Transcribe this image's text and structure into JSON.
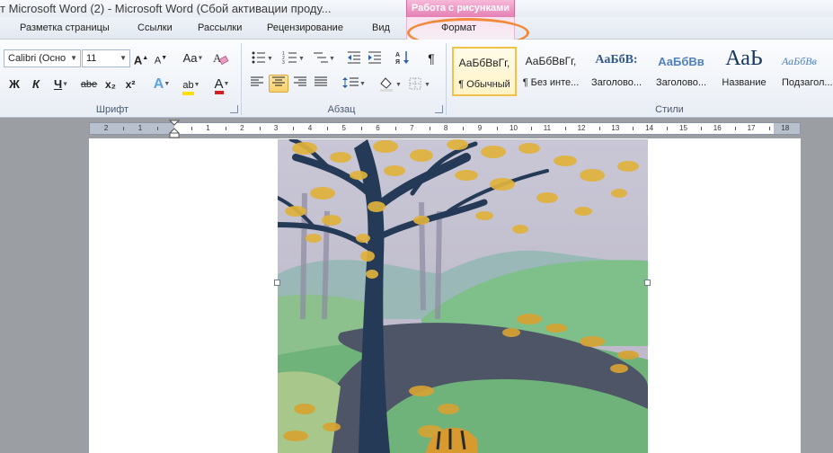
{
  "window": {
    "title": "т Microsoft Word (2)  -  Microsoft Word (Сбой активации проду...",
    "context_tab_title": "Работа с рисунками"
  },
  "tabs": [
    {
      "label": "Разметка страницы"
    },
    {
      "label": "Ссылки"
    },
    {
      "label": "Рассылки"
    },
    {
      "label": "Рецензирование"
    },
    {
      "label": "Вид"
    },
    {
      "label": "Формат"
    }
  ],
  "font_group": {
    "font_name": "Calibri (Осно",
    "font_size": "11",
    "grow_icon": "A",
    "shrink_icon": "A",
    "case_icon": "Aa",
    "bold": "Ж",
    "italic": "К",
    "underline": "Ч",
    "strike": "abe",
    "subscript": "x₂",
    "superscript": "x²",
    "effects_icon": "A",
    "highlight_icon": "ab",
    "color_icon": "A",
    "label": "Шрифт"
  },
  "paragraph_group": {
    "pilcrow": "¶",
    "label": "Абзац"
  },
  "styles_group": {
    "label": "Стили",
    "styles": [
      {
        "sample": "АаБбВвГг,",
        "name": "¶ Обычный"
      },
      {
        "sample": "АаБбВвГг,",
        "name": "¶ Без инте..."
      },
      {
        "sample": "АаБбВ:",
        "name": "Заголово..."
      },
      {
        "sample": "АаБбВв",
        "name": "Заголово..."
      },
      {
        "sample": "АаЬ",
        "name": "Название"
      },
      {
        "sample": "АаБбВв",
        "name": "Подзагол..."
      }
    ]
  },
  "ruler": {
    "labels": [
      "2",
      "1",
      "1",
      "2",
      "3",
      "4",
      "5",
      "6",
      "7",
      "8",
      "9",
      "10",
      "11",
      "12",
      "13",
      "14",
      "15",
      "16",
      "17",
      "18"
    ]
  },
  "colors": {
    "context_tab": "#e57fb5",
    "highlight_oval": "#f08a3a",
    "selected_style": "#f1c14a",
    "highlight_yellow": "#ffe000",
    "font_color_red": "#d42020",
    "heading_blue": "#2f5a8a"
  }
}
